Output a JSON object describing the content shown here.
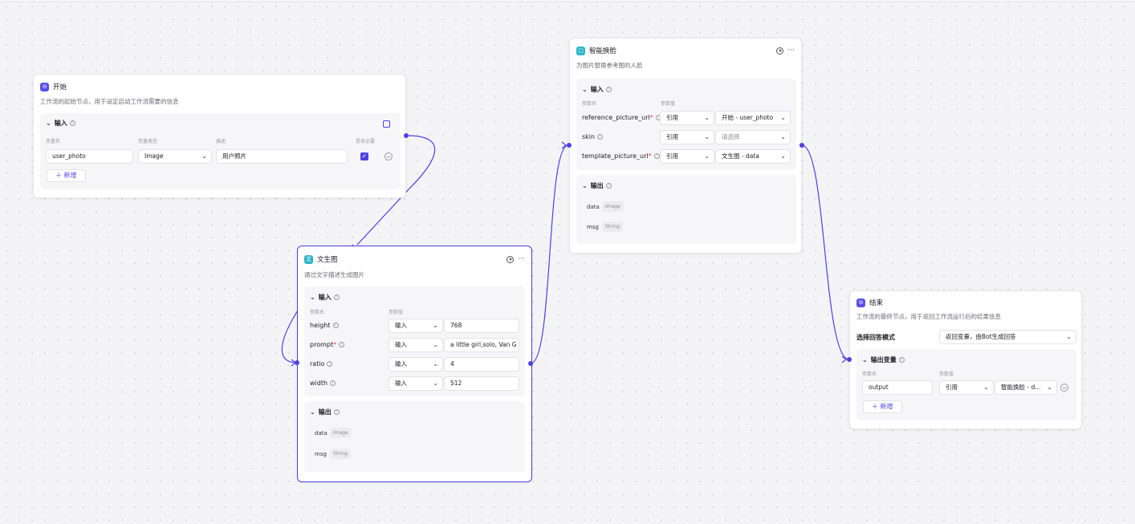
{
  "nodes": {
    "start": {
      "title": "开始",
      "desc": "工作流的起始节点，用于设定启动工作流需要的信息",
      "section": "输入",
      "cols": [
        "变量名",
        "变量类型",
        "描述",
        "是否必要"
      ],
      "row": {
        "name": "user_photo",
        "type": "Image",
        "desc": "用户照片"
      },
      "add_label": "新增",
      "icon": "start-icon",
      "color": "#5a4fe8"
    },
    "t2i": {
      "title": "文生图",
      "icon_char": "文",
      "desc": "通过文字描述生成图片",
      "input_section": "输入",
      "cols": [
        "参数名",
        "参数值"
      ],
      "params": [
        {
          "name": "height",
          "required": false,
          "mode": "输入",
          "value": "768"
        },
        {
          "name": "prompt",
          "required": true,
          "mode": "输入",
          "value": "a little girl,solo, Van G"
        },
        {
          "name": "ratio",
          "required": false,
          "mode": "输入",
          "value": "4"
        },
        {
          "name": "width",
          "required": false,
          "mode": "输入",
          "value": "512"
        }
      ],
      "output_section": "输出",
      "outputs": [
        {
          "name": "data",
          "type": "Image"
        },
        {
          "name": "msg",
          "type": "String"
        }
      ],
      "color": "#2bb6c9"
    },
    "face": {
      "title": "智能换脸",
      "desc": "为图片替换参考图的人脸",
      "input_section": "输入",
      "cols": [
        "参数名",
        "参数值"
      ],
      "params": [
        {
          "name": "reference_picture_url",
          "required": true,
          "mode": "引用",
          "value": "开始 - user_photo",
          "placeholder": false
        },
        {
          "name": "skin",
          "required": false,
          "mode": "引用",
          "value": "请选择",
          "placeholder": true
        },
        {
          "name": "template_picture_url",
          "required": true,
          "mode": "引用",
          "value": "文生图 - data",
          "placeholder": false
        }
      ],
      "output_section": "输出",
      "outputs": [
        {
          "name": "data",
          "type": "Image"
        },
        {
          "name": "msg",
          "type": "String"
        }
      ],
      "color": "#2bb6c9"
    },
    "end": {
      "title": "结束",
      "desc": "工作流的最终节点，用于返回工作流运行后的结果信息",
      "mode_label": "选择回答模式",
      "mode_value": "返回变量，由Bot生成回答",
      "output_section": "输出变量",
      "cols": [
        "参数名",
        "参数值"
      ],
      "row": {
        "name": "output",
        "mode": "引用",
        "value": "智能换脸 - d..."
      },
      "add_label": "新增",
      "color": "#5a4fe8"
    }
  }
}
